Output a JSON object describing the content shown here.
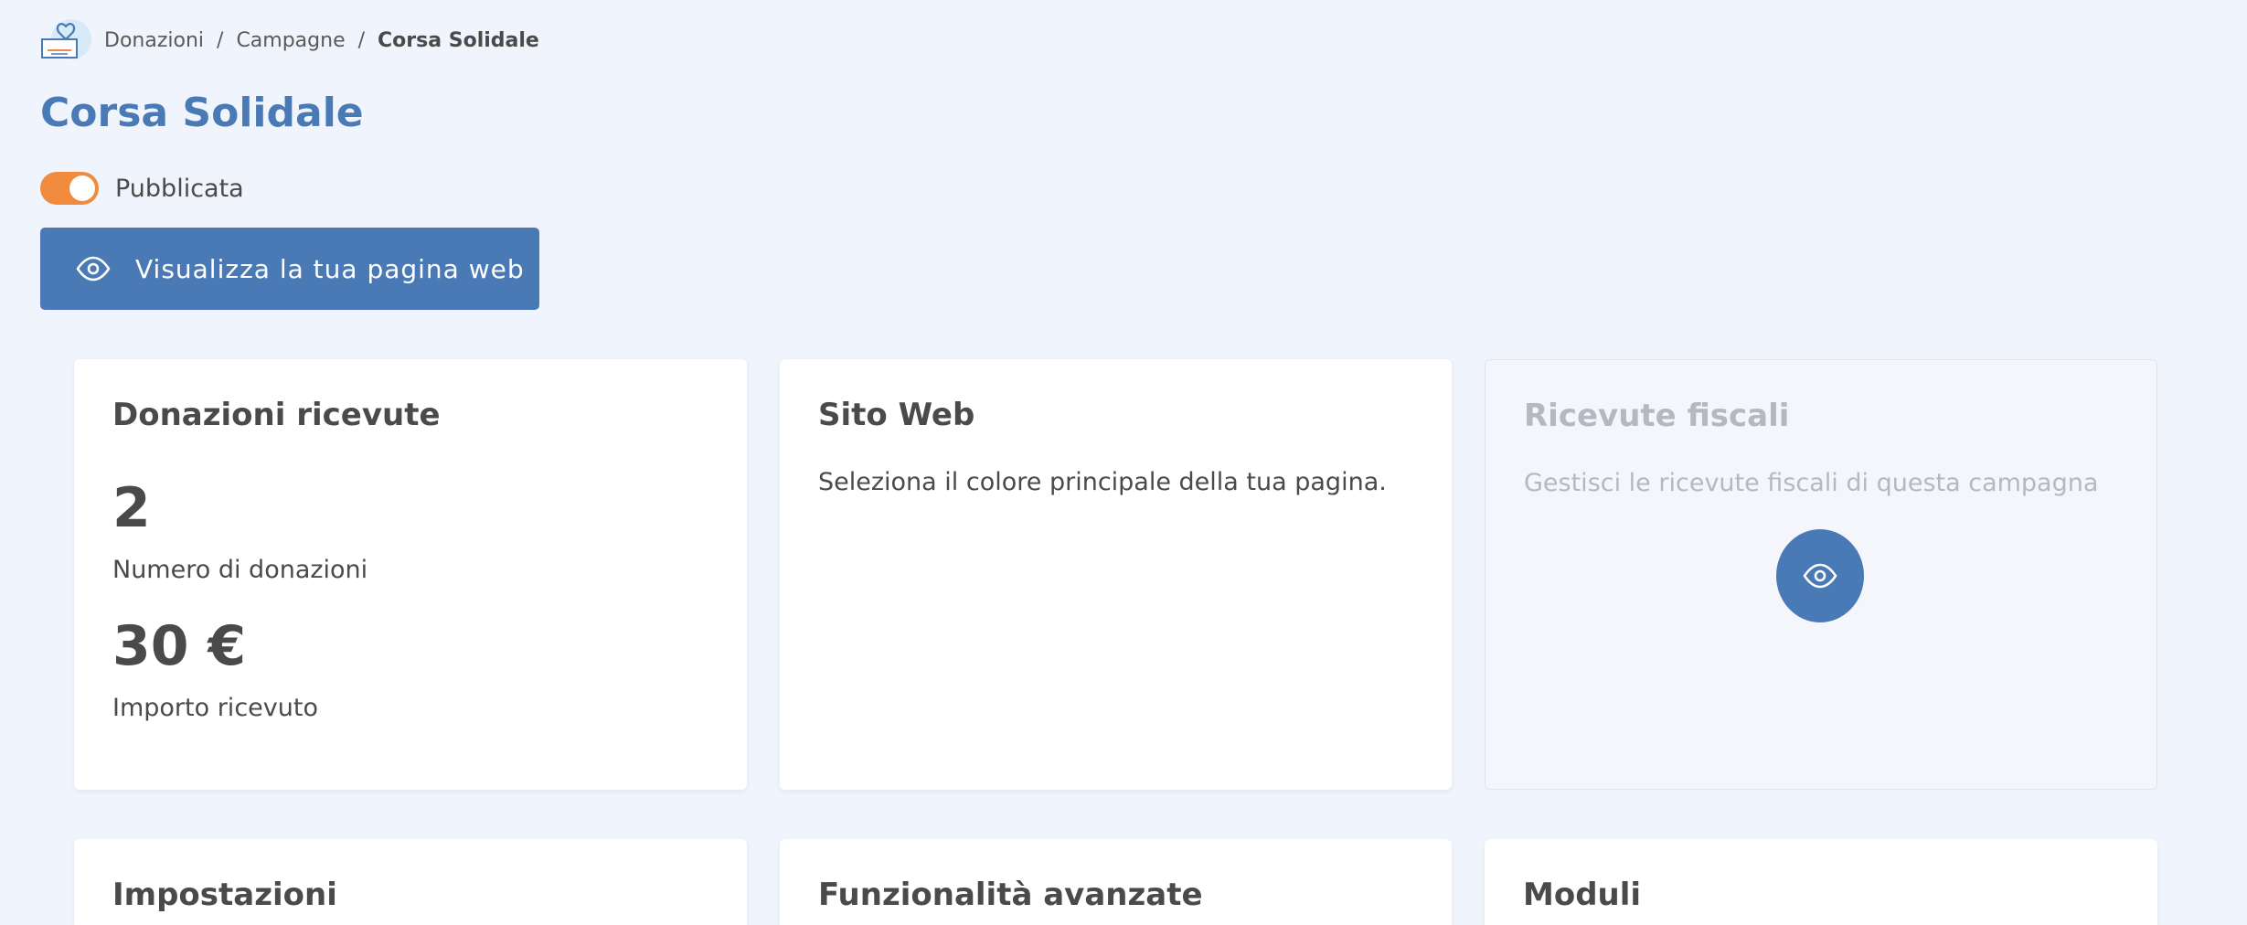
{
  "breadcrumb": {
    "items": [
      "Donazioni",
      "Campagne"
    ],
    "current": "Corsa Solidale",
    "separator": "/"
  },
  "page": {
    "title": "Corsa Solidale",
    "publish_label": "Pubblicata",
    "published": true,
    "view_button_label": "Visualizza la tua pagina web"
  },
  "cards": {
    "donations": {
      "title": "Donazioni ricevute",
      "count_value": "2",
      "count_label": "Numero di donazioni",
      "amount_value": "30 €",
      "amount_label": "Importo ricevuto"
    },
    "website": {
      "title": "Sito Web",
      "text": "Seleziona il colore principale della tua pagina."
    },
    "receipts": {
      "title": "Ricevute fiscali",
      "text": "Gestisci le ricevute fiscali di questa campagna"
    },
    "settings": {
      "title": "Impostazioni"
    },
    "advanced": {
      "title": "Funzionalità avanzate"
    },
    "modules": {
      "title": "Moduli"
    }
  },
  "icons": {
    "logo": "heart-box-icon",
    "view": "eye-icon"
  },
  "colors": {
    "accent": "#4a7ab5",
    "toggle_on": "#f08a3c",
    "background": "#f0f4fc"
  }
}
